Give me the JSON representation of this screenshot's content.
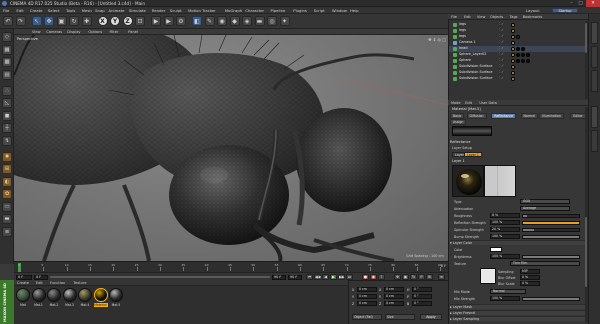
{
  "window": {
    "title": "CINEMA 4D R17.025 Studio (Beta - R16) - [Untitled 3.c4d] - Main"
  },
  "menubar": {
    "items": [
      "File",
      "Edit",
      "Create",
      "Select",
      "Tools",
      "Mesh",
      "Snap",
      "Animate",
      "Simulate",
      "Render",
      "Sculpt",
      "Motion Tracker",
      "MoGraph",
      "Character",
      "Pipeline",
      "Plugins",
      "Script",
      "Window",
      "Help"
    ],
    "layout_label": "Layout:",
    "layout_value": "Startup"
  },
  "toolbar": {
    "buttons": [
      {
        "name": "undo-button",
        "glyph": "↶",
        "style": ""
      },
      {
        "name": "redo-button",
        "glyph": "↷",
        "style": ""
      },
      {
        "name": "live-selection-button",
        "glyph": "↖",
        "style": "blue"
      },
      {
        "name": "move-button",
        "glyph": "✥",
        "style": "blue"
      },
      {
        "name": "scale-button",
        "glyph": "▣",
        "style": ""
      },
      {
        "name": "rotate-button",
        "glyph": "↻",
        "style": ""
      },
      {
        "name": "recent-tools-button",
        "glyph": "✚",
        "style": ""
      },
      {
        "name": "x-axis-button",
        "glyph": "X",
        "style": "light circ"
      },
      {
        "name": "y-axis-button",
        "glyph": "Y",
        "style": "light circ"
      },
      {
        "name": "z-axis-button",
        "glyph": "Z",
        "style": "light circ"
      },
      {
        "name": "coordinate-system-button",
        "glyph": "⊡",
        "style": ""
      },
      {
        "name": "render-view-button",
        "glyph": "▶",
        "style": ""
      },
      {
        "name": "render-picture-viewer-button",
        "glyph": "▶",
        "style": ""
      },
      {
        "name": "render-settings-button",
        "glyph": "⚙",
        "style": ""
      },
      {
        "name": "cube-button",
        "glyph": "◧",
        "style": "blue"
      },
      {
        "name": "spline-pen-button",
        "glyph": "✎",
        "style": ""
      },
      {
        "name": "subdivision-button",
        "glyph": "◉",
        "style": ""
      },
      {
        "name": "array-button",
        "glyph": "◆",
        "style": ""
      },
      {
        "name": "deformer-button",
        "glyph": "◈",
        "style": ""
      },
      {
        "name": "floor-button",
        "glyph": "▬",
        "style": ""
      },
      {
        "name": "camera-button",
        "glyph": "◎",
        "style": ""
      },
      {
        "name": "light-button",
        "glyph": "✦",
        "style": ""
      }
    ]
  },
  "left_tools": {
    "buttons": [
      {
        "name": "make-editable-button",
        "glyph": "◇",
        "style": ""
      },
      {
        "name": "model-mode-button",
        "glyph": "▦",
        "style": ""
      },
      {
        "name": "texture-mode-button",
        "glyph": "▩",
        "style": ""
      },
      {
        "name": "workplane-button",
        "glyph": "▤",
        "style": ""
      },
      {
        "name": "points-mode-button",
        "glyph": "∴",
        "style": ""
      },
      {
        "name": "edges-mode-button",
        "glyph": "◺",
        "style": ""
      },
      {
        "name": "polygons-mode-button",
        "glyph": "◼",
        "style": ""
      },
      {
        "name": "enable-axis-button",
        "glyph": "┼",
        "style": ""
      },
      {
        "name": "tweak-button",
        "glyph": "↯",
        "style": ""
      },
      {
        "name": "snap-button",
        "glyph": "✸",
        "style": "orange"
      },
      {
        "name": "workplane-lock-button",
        "glyph": "⊞",
        "style": "orange"
      },
      {
        "name": "solo-button",
        "glyph": "◐",
        "style": "orange"
      },
      {
        "name": "sculpt-button",
        "glyph": "✿",
        "style": "orange"
      },
      {
        "name": "planar-workplane-button",
        "glyph": "▭",
        "style": ""
      },
      {
        "name": "locked-workplane-button",
        "glyph": "▬",
        "style": ""
      },
      {
        "name": "scene-layer-button",
        "glyph": "≡",
        "style": ""
      }
    ]
  },
  "viewport": {
    "menu": [
      "View",
      "Cameras",
      "Display",
      "Options",
      "Filter",
      "Panel"
    ],
    "label": "Perspective",
    "grid_spacing": "Grid Spacing : 100 cm"
  },
  "timeline": {
    "start_frame": "0 F",
    "current": "0 F",
    "end_frame": "90 F",
    "end_frame2": "90 F",
    "ticks": [
      "0",
      "5",
      "10",
      "15",
      "20",
      "25",
      "30",
      "35",
      "40",
      "45",
      "50",
      "55",
      "60",
      "65",
      "70",
      "75",
      "80",
      "85",
      "90"
    ],
    "frame_display": "0 F"
  },
  "material_manager": {
    "menu": [
      "Create",
      "Edit",
      "Function",
      "Texture"
    ],
    "materials": [
      {
        "name": "Mat",
        "color": "#3a4a3a",
        "hi": "#6b8b6b"
      },
      {
        "name": "Mat.1",
        "color": "#2a2a2a",
        "hi": "#9a9a9a"
      },
      {
        "name": "Mat.2",
        "color": "#2a2a2a",
        "hi": "#8a8a8a"
      },
      {
        "name": "Mat.3",
        "color": "#2a2a2a",
        "hi": "#c0c0c0"
      },
      {
        "name": "Mat.4",
        "color": "#3a3a2a",
        "hi": "#a89c6a"
      },
      {
        "name": "Material",
        "color": "#111",
        "hi": "#d2a000"
      },
      {
        "name": "Mat.5",
        "color": "#2a2a2a",
        "hi": "#b8b8b8"
      }
    ],
    "selected_index": 5
  },
  "coordinates": {
    "rows": [
      {
        "axis": "X",
        "pos": "0 cm",
        "size": "0 cm",
        "rot_label": "H",
        "rot": "0 °"
      },
      {
        "axis": "Y",
        "pos": "0 cm",
        "size": "0 cm",
        "rot_label": "P",
        "rot": "0 °"
      },
      {
        "axis": "Z",
        "pos": "0 cm",
        "size": "0 cm",
        "rot_label": "B",
        "rot": "0 °"
      }
    ],
    "mode_left": "Object (Rel)",
    "mode_right": "Size",
    "apply_label": "Apply"
  },
  "sidebar": {
    "label": "MAXON CINEMA 4D"
  },
  "objects": {
    "menu": [
      "File",
      "Edit",
      "View",
      "Objects",
      "Tags",
      "Bookmarks"
    ],
    "items": [
      {
        "name": "legs",
        "color": "#58a858",
        "tags": [
          "#c8a060"
        ]
      },
      {
        "name": "legs",
        "color": "#58a858",
        "tags": [
          "#c8a060"
        ]
      },
      {
        "name": "legs",
        "color": "#58a858",
        "tags": [
          "#c8a060",
          "#333"
        ]
      },
      {
        "name": "Camera.1",
        "color": "#7aa0c8",
        "tags": [
          "#aaa"
        ]
      },
      {
        "name": "head",
        "color": "#58a858",
        "tags": [
          "#c8a060",
          "#111",
          "#111"
        ]
      },
      {
        "name": "Sphere_Layer02",
        "color": "#58a858",
        "tags": [
          "#c8a060",
          "#111",
          "#111",
          "#111"
        ]
      },
      {
        "name": "Sphere",
        "color": "#58a858",
        "tags": [
          "#c8a060",
          "#111",
          "#111",
          "#111"
        ]
      },
      {
        "name": "Subdivision Surface",
        "color": "#58a858",
        "tags": [
          "#c8a060"
        ]
      },
      {
        "name": "Subdivision Surface",
        "color": "#58a858",
        "tags": [
          "#c8a060"
        ]
      },
      {
        "name": "Subdivision Surface",
        "color": "#58a858",
        "tags": [
          "#c8a060"
        ]
      }
    ]
  },
  "attributes": {
    "menu": [
      "Mode",
      "Edit",
      "User Data"
    ],
    "header": "Material [Mat.5]",
    "tabs": [
      "Basic",
      "Diffusion",
      "Reflectance",
      "Normal",
      "Illumination",
      "Editor"
    ],
    "active_tab": 2,
    "tab2": [
      "Assign"
    ],
    "section": "Reflectance",
    "layer_setup_label": "Layer Setup",
    "layer_buttons": [
      "Layers",
      "Layer 1"
    ],
    "layer_name": "Layer 1",
    "properties": [
      {
        "label": "Type",
        "value": "",
        "drop": "GGX",
        "bar": null
      },
      {
        "label": "Attenuation",
        "value": "",
        "drop": "Average",
        "bar": null
      },
      {
        "label": "Roughness",
        "value": "8 %",
        "drop": null,
        "bar": 0.08,
        "or": false
      },
      {
        "label": "Reflection Strength",
        "value": "100 %",
        "drop": null,
        "bar": 1.0,
        "or": true
      },
      {
        "label": "Specular Strength",
        "value": "20 %",
        "drop": null,
        "bar": 0.2,
        "or": false
      },
      {
        "label": "Bump Strength",
        "value": "100 %",
        "drop": null,
        "bar": 1.0,
        "or": false
      }
    ],
    "layer_color_hdr": "▾ Layer Color",
    "color_label": "Color",
    "brightness_label": "Brightness",
    "brightness_value": "100 %",
    "texture_label": "Texture",
    "texture_drop": "Thin Film",
    "sampling_label": "Sampling",
    "sampling_value": "MIP",
    "blur_label": "Blur Offset",
    "blur_value": "0 %",
    "blur_scale_label": "Blur Scale",
    "blur_scale_value": "0 %",
    "mix_mode_label": "Mix Mode",
    "mix_mode_value": "Normal",
    "mix_strength_label": "Mix Strength",
    "mix_strength_value": "100 %",
    "collapsed": [
      "▸ Layer Mask",
      "▸ Layer Fresnel",
      "▸ Layer Sampling"
    ]
  },
  "colors": {
    "accent_blue": "#5d7fb0",
    "accent_orange": "#e9a020",
    "maxon_green": "#3a7a2a"
  }
}
